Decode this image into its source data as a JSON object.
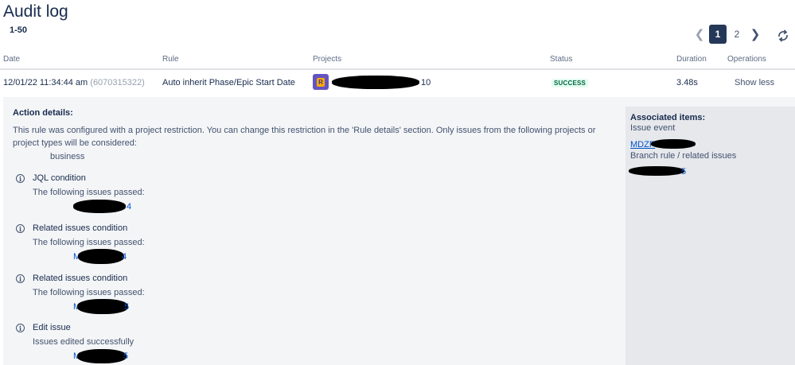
{
  "header": {
    "title": "Audit log",
    "range": "1-50"
  },
  "pagination": {
    "prev_icon": "chevron-left-icon",
    "next_icon": "chevron-right-icon",
    "pages": [
      "1",
      "2"
    ],
    "current_page": "1",
    "refresh_icon": "refresh-icon"
  },
  "table": {
    "columns": {
      "date": "Date",
      "rule": "Rule",
      "projects": "Projects",
      "status": "Status",
      "duration": "Duration",
      "operations": "Operations"
    },
    "rows": [
      {
        "date": "12/01/22 11:34:44 am",
        "execution_id": "(6070315322)",
        "rule": "Auto inherit Phase/Epic Start Date",
        "project_suffix": "10",
        "status": "SUCCESS",
        "duration": "3.48s",
        "operation": "Show less"
      }
    ]
  },
  "details": {
    "title": "Action details:",
    "description": "This rule was configured with a project restriction. You can change this restriction in the 'Rule details' section. Only issues from the following projects or project types will be considered:",
    "project_type": "business",
    "conditions": [
      {
        "title": "JQL condition",
        "subtitle": "The following issues passed:",
        "issue_suffix": "4"
      },
      {
        "title": "Related issues condition",
        "subtitle": "The following issues passed:",
        "issue_prefix": "M",
        "issue_suffix": "4"
      },
      {
        "title": "Related issues condition",
        "subtitle": "The following issues passed:",
        "issue_prefix": "M",
        "issue_suffix": "5"
      },
      {
        "title": "Edit issue",
        "subtitle": "Issues edited successfully",
        "issue_prefix": "M",
        "issue_suffix": "5"
      }
    ]
  },
  "associated": {
    "title": "Associated items:",
    "issue_event_label": "Issue event",
    "issue_event_link": "MDZP",
    "branch_label": "Branch rule / related issues",
    "branch_link_suffix": "5"
  },
  "colors": {
    "active_page": "#253858",
    "success_text": "#006644",
    "success_bg": "#e3fcef",
    "link": "#0052cc",
    "project_avatar": "#6554c0"
  }
}
